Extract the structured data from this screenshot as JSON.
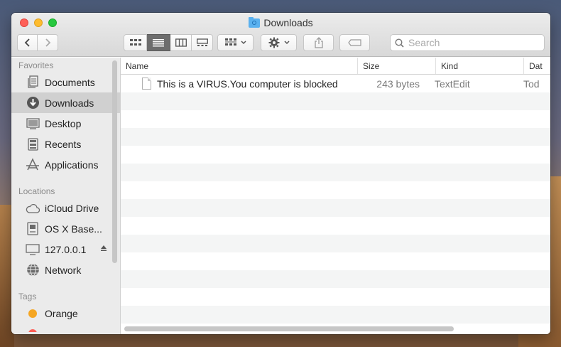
{
  "window": {
    "title": "Downloads"
  },
  "toolbar": {
    "search_placeholder": "Search"
  },
  "sidebar": {
    "favorites_header": "Favorites",
    "favorites": [
      {
        "label": "Documents",
        "icon": "documents-icon"
      },
      {
        "label": "Downloads",
        "icon": "downloads-icon",
        "selected": true
      },
      {
        "label": "Desktop",
        "icon": "desktop-icon"
      },
      {
        "label": "Recents",
        "icon": "recents-icon"
      },
      {
        "label": "Applications",
        "icon": "applications-icon"
      }
    ],
    "locations_header": "Locations",
    "locations": [
      {
        "label": "iCloud Drive",
        "icon": "cloud-icon"
      },
      {
        "label": "OS X Base...",
        "icon": "disk-icon"
      },
      {
        "label": "127.0.0.1",
        "icon": "display-icon",
        "eject": true
      },
      {
        "label": "Network",
        "icon": "network-icon"
      }
    ],
    "tags_header": "Tags",
    "tags": [
      {
        "label": "Orange",
        "color": "#f5a623"
      }
    ]
  },
  "columns": {
    "name": "Name",
    "size": "Size",
    "kind": "Kind",
    "date": "Dat"
  },
  "files": [
    {
      "name": "This is a VIRUS.You computer is blocked",
      "size": "243 bytes",
      "kind": "TextEdit",
      "date": "Tod"
    }
  ],
  "colors": {
    "accent_folder": "#5ab1ef",
    "selected_sidebar": "#d0d0d0",
    "tag_red": "#fe5f57"
  }
}
